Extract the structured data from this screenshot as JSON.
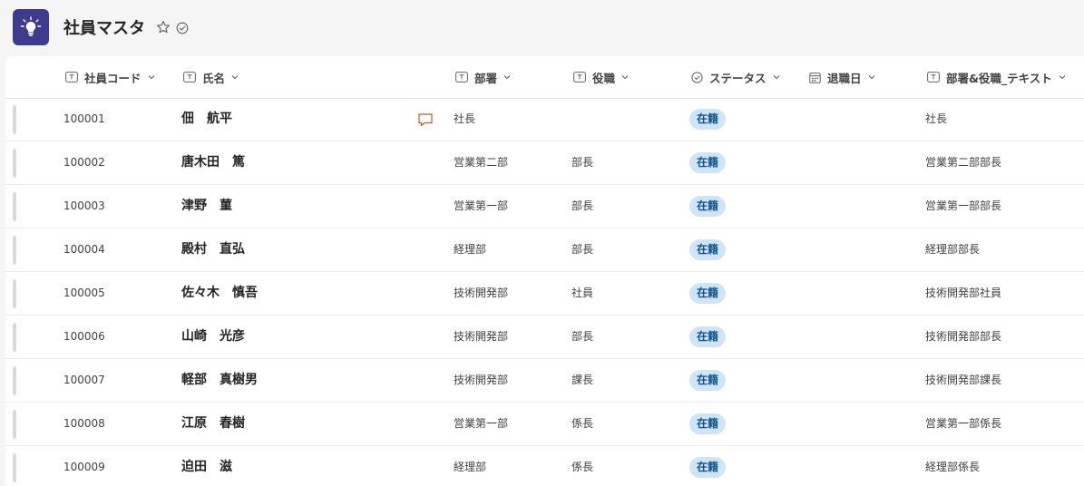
{
  "header": {
    "title": "社員マスタ",
    "app_icon": "lightbulb-icon",
    "favorite_icon": "star-outline-icon",
    "follow_icon": "check-circle-icon"
  },
  "columns": [
    {
      "label": "社員コード",
      "icon": "text-field-icon"
    },
    {
      "label": "氏名",
      "icon": "text-field-icon"
    },
    {
      "label": "部署",
      "icon": "text-field-icon"
    },
    {
      "label": "役職",
      "icon": "text-field-icon"
    },
    {
      "label": "ステータス",
      "icon": "choice-icon"
    },
    {
      "label": "退職日",
      "icon": "calendar-icon"
    },
    {
      "label": "部署&役職_テキスト",
      "icon": "text-field-icon"
    }
  ],
  "rows": [
    {
      "code": "100001",
      "name": "佃　航平",
      "dept": "社長",
      "title": "",
      "status": "在籍",
      "retire": "",
      "dept_title": "社長",
      "has_comment": true
    },
    {
      "code": "100002",
      "name": "唐木田　篤",
      "dept": "営業第二部",
      "title": "部長",
      "status": "在籍",
      "retire": "",
      "dept_title": "営業第二部部長"
    },
    {
      "code": "100003",
      "name": "津野　菫",
      "dept": "営業第一部",
      "title": "部長",
      "status": "在籍",
      "retire": "",
      "dept_title": "営業第一部部長"
    },
    {
      "code": "100004",
      "name": "殿村　直弘",
      "dept": "経理部",
      "title": "部長",
      "status": "在籍",
      "retire": "",
      "dept_title": "経理部部長"
    },
    {
      "code": "100005",
      "name": "佐々木　慎吾",
      "dept": "技術開発部",
      "title": "社員",
      "status": "在籍",
      "retire": "",
      "dept_title": "技術開発部社員"
    },
    {
      "code": "100006",
      "name": "山崎　光彦",
      "dept": "技術開発部",
      "title": "部長",
      "status": "在籍",
      "retire": "",
      "dept_title": "技術開発部部長"
    },
    {
      "code": "100007",
      "name": "軽部　真樹男",
      "dept": "技術開発部",
      "title": "課長",
      "status": "在籍",
      "retire": "",
      "dept_title": "技術開発部課長"
    },
    {
      "code": "100008",
      "name": "江原　春樹",
      "dept": "営業第一部",
      "title": "係長",
      "status": "在籍",
      "retire": "",
      "dept_title": "営業第一部係長"
    },
    {
      "code": "100009",
      "name": "迫田　滋",
      "dept": "経理部",
      "title": "係長",
      "status": "在籍",
      "retire": "",
      "dept_title": "経理部係長"
    }
  ],
  "colors": {
    "app_icon_bg": "#3f3b8c",
    "status_pill_bg": "#cfe4f7",
    "status_pill_text": "#0f548c",
    "comment_icon": "#c4572a"
  }
}
